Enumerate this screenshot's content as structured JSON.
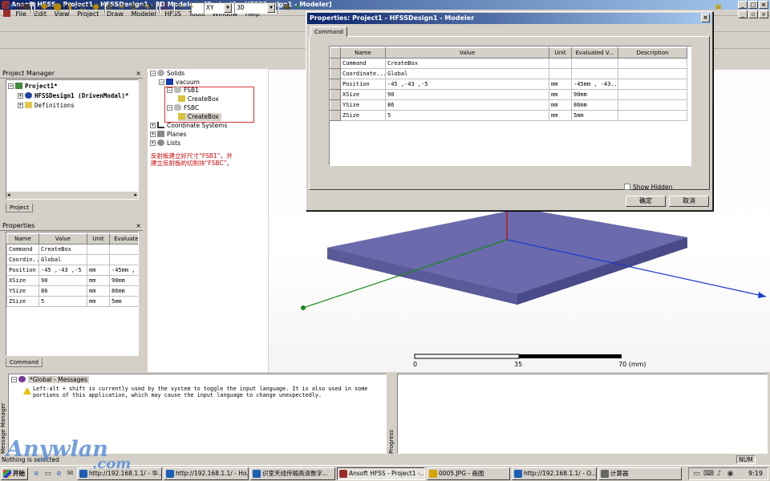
{
  "window": {
    "title": "Ansoft HFSS - Project1 - HFSSDesign1 - 3D Modeler - [Project1 - HFSSDesign1 - Modeler]"
  },
  "menu": [
    "File",
    "Edit",
    "View",
    "Project",
    "Draw",
    "Modeler",
    "HFSS",
    "Tools",
    "Window",
    "Help"
  ],
  "toolbar": {
    "plane_select": "XY",
    "view_select": "3D"
  },
  "project_manager": {
    "title": "Project Manager",
    "project": "Project1*",
    "design": "HFSSDesign1 (DrivenModal)*",
    "definitions": "Definitions",
    "tab": "Project"
  },
  "properties_panel": {
    "title": "Properties",
    "headers": [
      "Name",
      "Value",
      "Unit",
      "Evaluate"
    ],
    "rows": [
      [
        "Command",
        "CreateBox",
        "",
        ""
      ],
      [
        "Coordin...",
        "Global",
        "",
        ""
      ],
      [
        "Position",
        "-45 ,-43 ,-5",
        "mm",
        "-45mm ,"
      ],
      [
        "XSize",
        "90",
        "mm",
        "90mm"
      ],
      [
        "YSize",
        "86",
        "mm",
        "86mm"
      ],
      [
        "ZSize",
        "5",
        "mm",
        "5mm"
      ]
    ],
    "tab": "Command"
  },
  "model_tree": {
    "solids": "Solids",
    "vacuum": "vacuum",
    "fsb1": "FSB1",
    "fsb1_cmd": "CreateBox",
    "fsbc": "FSBC",
    "fsbc_cmd": "CreateBox",
    "coord": "Coordinate Systems",
    "planes": "Planes",
    "lists": "Lists",
    "annotation_line1": "反射板建立好尺寸“FSB1”，并",
    "annotation_line2": "建立反射板的切割块“FSBC”。"
  },
  "scale_bar": {
    "labels": [
      "0",
      "35",
      "70 (mm)"
    ]
  },
  "dialog": {
    "title": "Properties: Project1 - HFSSDesign1 - Modeler",
    "tab": "Command",
    "headers": [
      "Name",
      "Value",
      "Unit",
      "Evaluated V...",
      "Description"
    ],
    "rows": [
      [
        "Command",
        "CreateBox",
        "",
        "",
        ""
      ],
      [
        "Coordinate...",
        "Global",
        "",
        "",
        ""
      ],
      [
        "Position",
        "-45 ,-43 ,-5",
        "mm",
        "-45mm , -43...",
        ""
      ],
      [
        "XSize",
        "90",
        "mm",
        "90mm",
        ""
      ],
      [
        "YSize",
        "86",
        "mm",
        "86mm",
        ""
      ],
      [
        "ZSize",
        "5",
        "mm",
        "5mm",
        ""
      ]
    ],
    "show_hidden": "Show Hidden",
    "ok": "确定",
    "cancel": "取消"
  },
  "messages": {
    "side_label": "Message Manager",
    "root": "*Global - Messages",
    "warning_line1": "Left-alt + shift is currently used by the system to toggle the input language. It is also used in some",
    "warning_line2": "portions of this application, which may cause the input language to change unexpectedly.",
    "progress_label": "Progress"
  },
  "status": {
    "left": "Nothing is selected",
    "num": "NUM"
  },
  "taskbar": {
    "start": "开始",
    "items": [
      "http://192.168.1.1/ - 华...",
      "http://192.168.1.1/ - Ho...",
      "识室天线传输高清数字...",
      "Ansoft HFSS - Project1 -...",
      "0005.JPG - 画图",
      "http://192.168.1.1/ - O...",
      "计算器"
    ],
    "clock": "9:19"
  },
  "watermark": "Anywlan",
  "watermark_suffix": ".com"
}
